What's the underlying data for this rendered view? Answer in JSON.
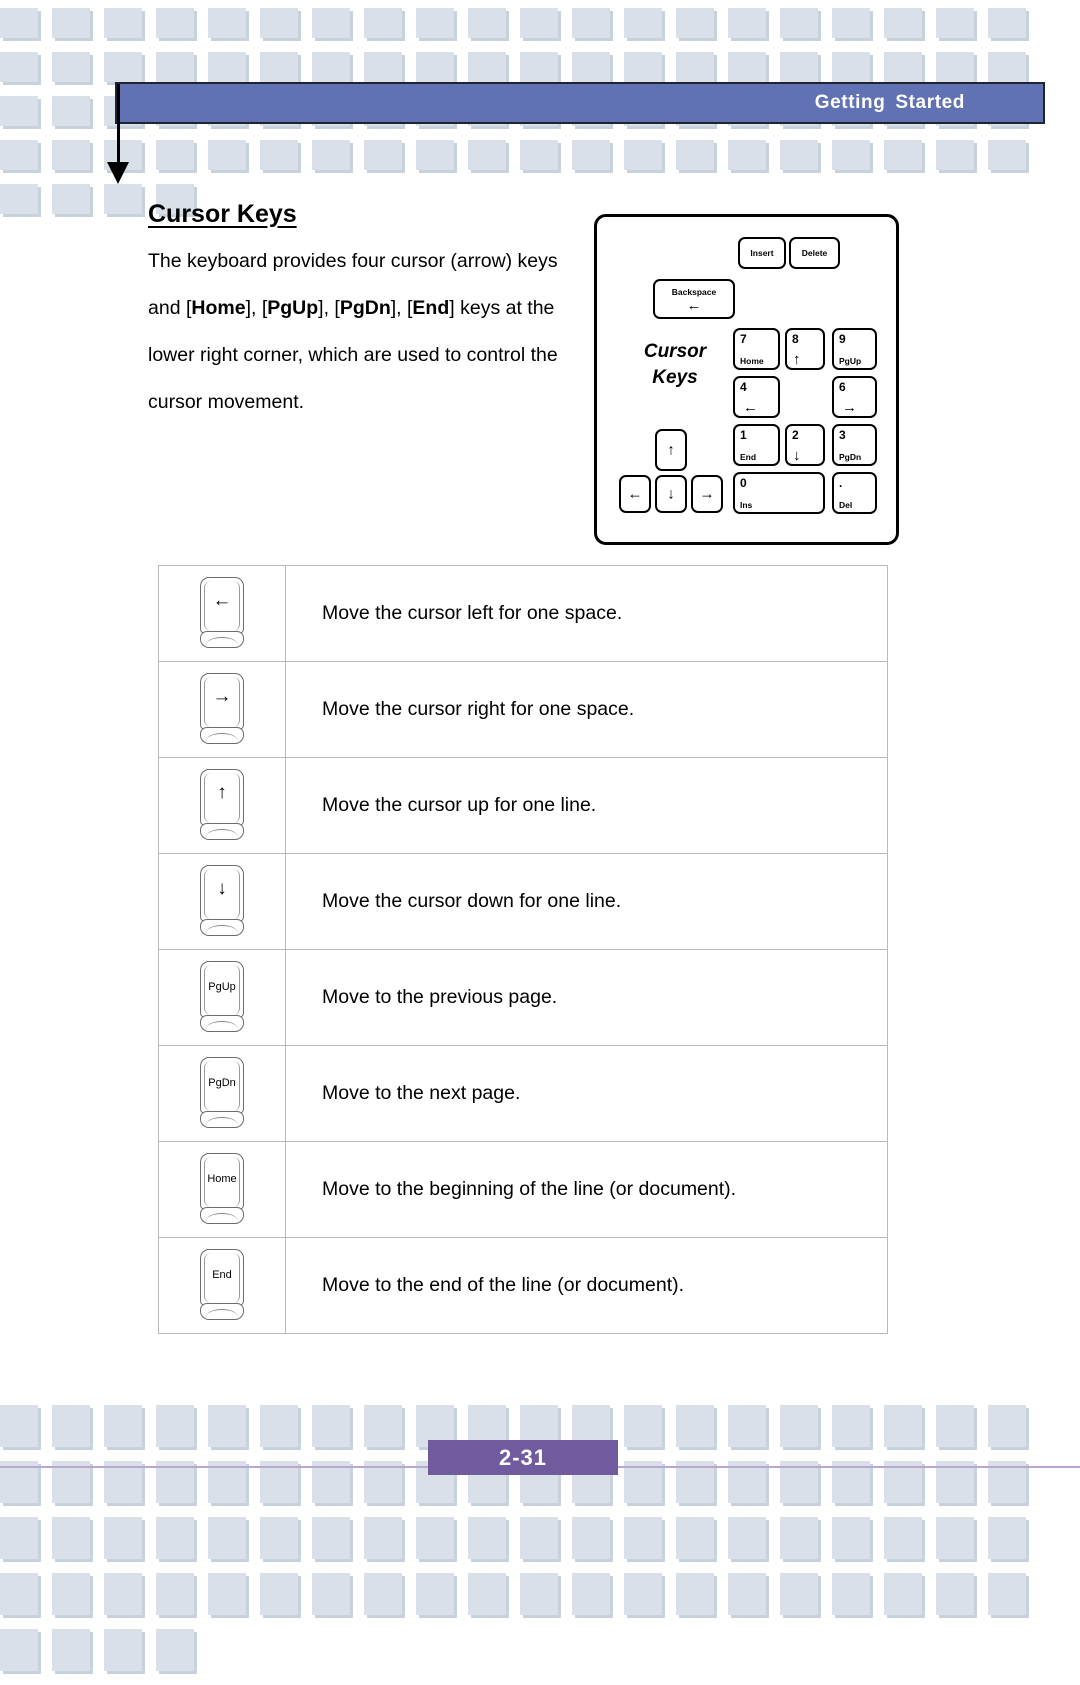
{
  "header": {
    "title": "Getting  Started",
    "bar_color": "#6072b4"
  },
  "section": {
    "title": "Cursor Keys",
    "paragraph_parts": [
      {
        "text": "The keyboard provides four cursor (arrow) keys and [",
        "bold": false
      },
      {
        "text": "Home",
        "bold": true
      },
      {
        "text": "], [",
        "bold": false
      },
      {
        "text": "PgUp",
        "bold": true
      },
      {
        "text": "], [",
        "bold": false
      },
      {
        "text": "PgDn",
        "bold": true
      },
      {
        "text": "], [",
        "bold": false
      },
      {
        "text": "End",
        "bold": true
      },
      {
        "text": "] keys at the lower right corner, which are used to control the cursor movement.",
        "bold": false
      }
    ]
  },
  "keyboard_figure": {
    "caption_line1": "Cursor",
    "caption_line2": "Keys",
    "keys": [
      {
        "name": "insert",
        "label_center": "Insert"
      },
      {
        "name": "delete",
        "label_center": "Delete"
      },
      {
        "name": "backspace",
        "label_center": "Backspace",
        "arrow": "←"
      },
      {
        "name": "numpad-7-home",
        "label_top": "7",
        "label_bottom": "Home"
      },
      {
        "name": "numpad-8-up",
        "label_top": "8",
        "arrow": "↑"
      },
      {
        "name": "numpad-9-pgup",
        "label_top": "9",
        "label_bottom": "PgUp"
      },
      {
        "name": "numpad-4-left",
        "label_top": "4",
        "arrow": "←"
      },
      {
        "name": "numpad-6-right",
        "label_top": "6",
        "arrow": "→"
      },
      {
        "name": "numpad-1-end",
        "label_top": "1",
        "label_bottom": "End"
      },
      {
        "name": "numpad-2-down",
        "label_top": "2",
        "arrow": "↓"
      },
      {
        "name": "numpad-3-pgdn",
        "label_top": "3",
        "label_bottom": "PgDn"
      },
      {
        "name": "numpad-0-ins",
        "label_top": "0",
        "label_bottom": "Ins"
      },
      {
        "name": "numpad-dot-del",
        "label_top": ".",
        "label_bottom": "Del"
      },
      {
        "name": "arrow-up",
        "arrow": "↑"
      },
      {
        "name": "arrow-left",
        "arrow": "←"
      },
      {
        "name": "arrow-down",
        "arrow": "↓"
      },
      {
        "name": "arrow-right",
        "arrow": "→"
      }
    ]
  },
  "key_table": {
    "rows": [
      {
        "key_name": "arrow-left-key",
        "key_label": "←",
        "is_glyph": true,
        "description": "Move the cursor left for one space."
      },
      {
        "key_name": "arrow-right-key",
        "key_label": "→",
        "is_glyph": true,
        "description": "Move the cursor right for one space."
      },
      {
        "key_name": "arrow-up-key",
        "key_label": "↑",
        "is_glyph": true,
        "description": "Move the cursor up for one line."
      },
      {
        "key_name": "arrow-down-key",
        "key_label": "↓",
        "is_glyph": true,
        "description": "Move the cursor down for one line."
      },
      {
        "key_name": "pgup-key",
        "key_label": "PgUp",
        "is_glyph": false,
        "description": "Move to the previous page."
      },
      {
        "key_name": "pgdn-key",
        "key_label": "PgDn",
        "is_glyph": false,
        "description": "Move to the next page."
      },
      {
        "key_name": "home-key",
        "key_label": "Home",
        "is_glyph": false,
        "description": "Move to the beginning of the line (or document)."
      },
      {
        "key_name": "end-key",
        "key_label": "End",
        "is_glyph": false,
        "description": "Move to the end of the line (or document)."
      }
    ]
  },
  "footer": {
    "page_number": "2-31",
    "badge_color": "#6f5b9e",
    "rule_color": "#b9a6d4"
  },
  "decor": {
    "square_color": "#dae0e8",
    "square_shadow": "#c7d2dd"
  }
}
